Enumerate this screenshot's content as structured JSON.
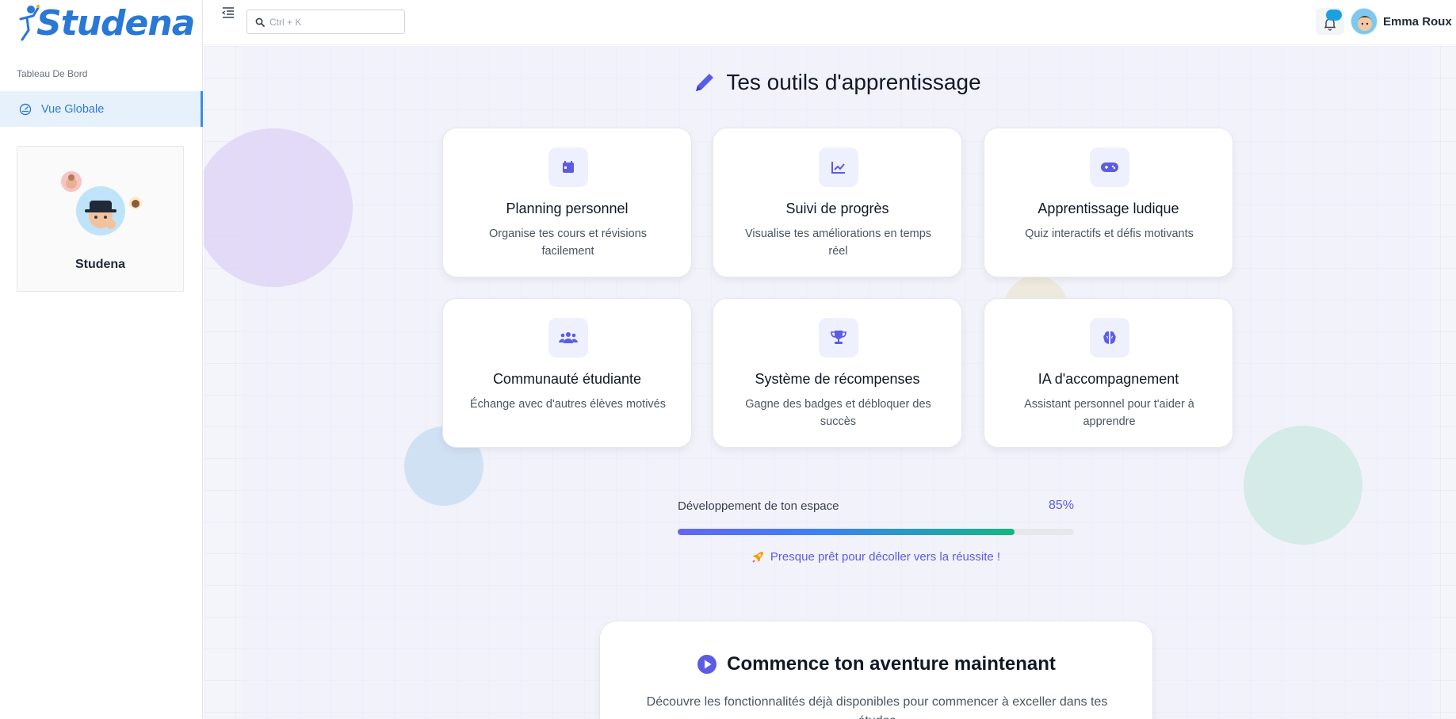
{
  "app": {
    "logo_text": "Studena"
  },
  "sidebar": {
    "section_label": "Tableau De Bord",
    "nav": [
      {
        "label": "Vue Globale",
        "icon": "dashboard-gauge-icon",
        "active": true
      }
    ],
    "profile": {
      "name": "Studena"
    }
  },
  "header": {
    "search": {
      "placeholder": "Ctrl + K"
    },
    "user": {
      "name": "Emma Roux"
    }
  },
  "main": {
    "title": "Tes outils d'apprentissage",
    "title_icon": "pencil-icon",
    "cards": [
      {
        "title": "Planning personnel",
        "desc": "Organise tes cours et révisions facilement",
        "icon": "calendar-icon"
      },
      {
        "title": "Suivi de progrès",
        "desc": "Visualise tes améliorations en temps réel",
        "icon": "chart-line-icon"
      },
      {
        "title": "Apprentissage ludique",
        "desc": "Quiz interactifs et défis motivants",
        "icon": "gamepad-icon"
      },
      {
        "title": "Communauté étudiante",
        "desc": "Échange avec d'autres élèves motivés",
        "icon": "users-icon"
      },
      {
        "title": "Système de récompenses",
        "desc": "Gagne des badges et débloquer des succès",
        "icon": "trophy-icon"
      },
      {
        "title": "IA d'accompagnement",
        "desc": "Assistant personnel pour t'aider à apprendre",
        "icon": "brain-icon"
      }
    ],
    "progress": {
      "label": "Développement de ton espace",
      "value_text": "85%",
      "value": 0.85,
      "message": "Presque prêt pour décoller vers la réussite !"
    },
    "cta": {
      "title": "Commence ton aventure maintenant",
      "text": "Découvre les fonctionnalités déjà disponibles pour commencer à exceller dans tes études"
    }
  },
  "colors": {
    "accent": "#5b5ce6",
    "brand": "#2a78d6",
    "success": "#10b981"
  }
}
